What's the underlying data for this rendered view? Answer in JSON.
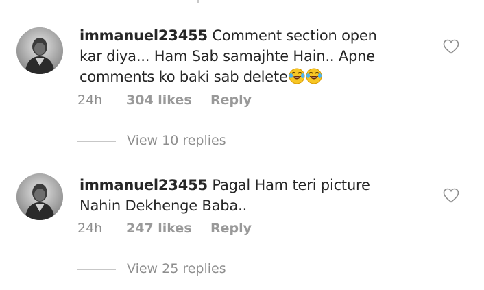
{
  "comments": [
    {
      "username": "immanuel23455",
      "text": "Comment section open kar diya... Ham Sab samajhte Hain.. Apne comments ko baki sab delete",
      "emoji": [
        "face-with-tears-of-joy",
        "face-with-tears-of-joy"
      ],
      "time": "24h",
      "likes": "304 likes",
      "reply_label": "Reply",
      "view_replies": "View 10 replies"
    },
    {
      "username": "immanuel23455",
      "text": "Pagal Ham teri picture Nahin Dekhenge Baba..",
      "emoji": [],
      "time": "24h",
      "likes": "247 likes",
      "reply_label": "Reply",
      "view_replies": "View 25 replies"
    }
  ],
  "icons": {
    "like": "heart-outline-icon",
    "emoji": "face-with-tears-of-joy"
  },
  "colors": {
    "text": "#262626",
    "muted": "#8e8e8e",
    "divider": "#c7c7c7"
  }
}
